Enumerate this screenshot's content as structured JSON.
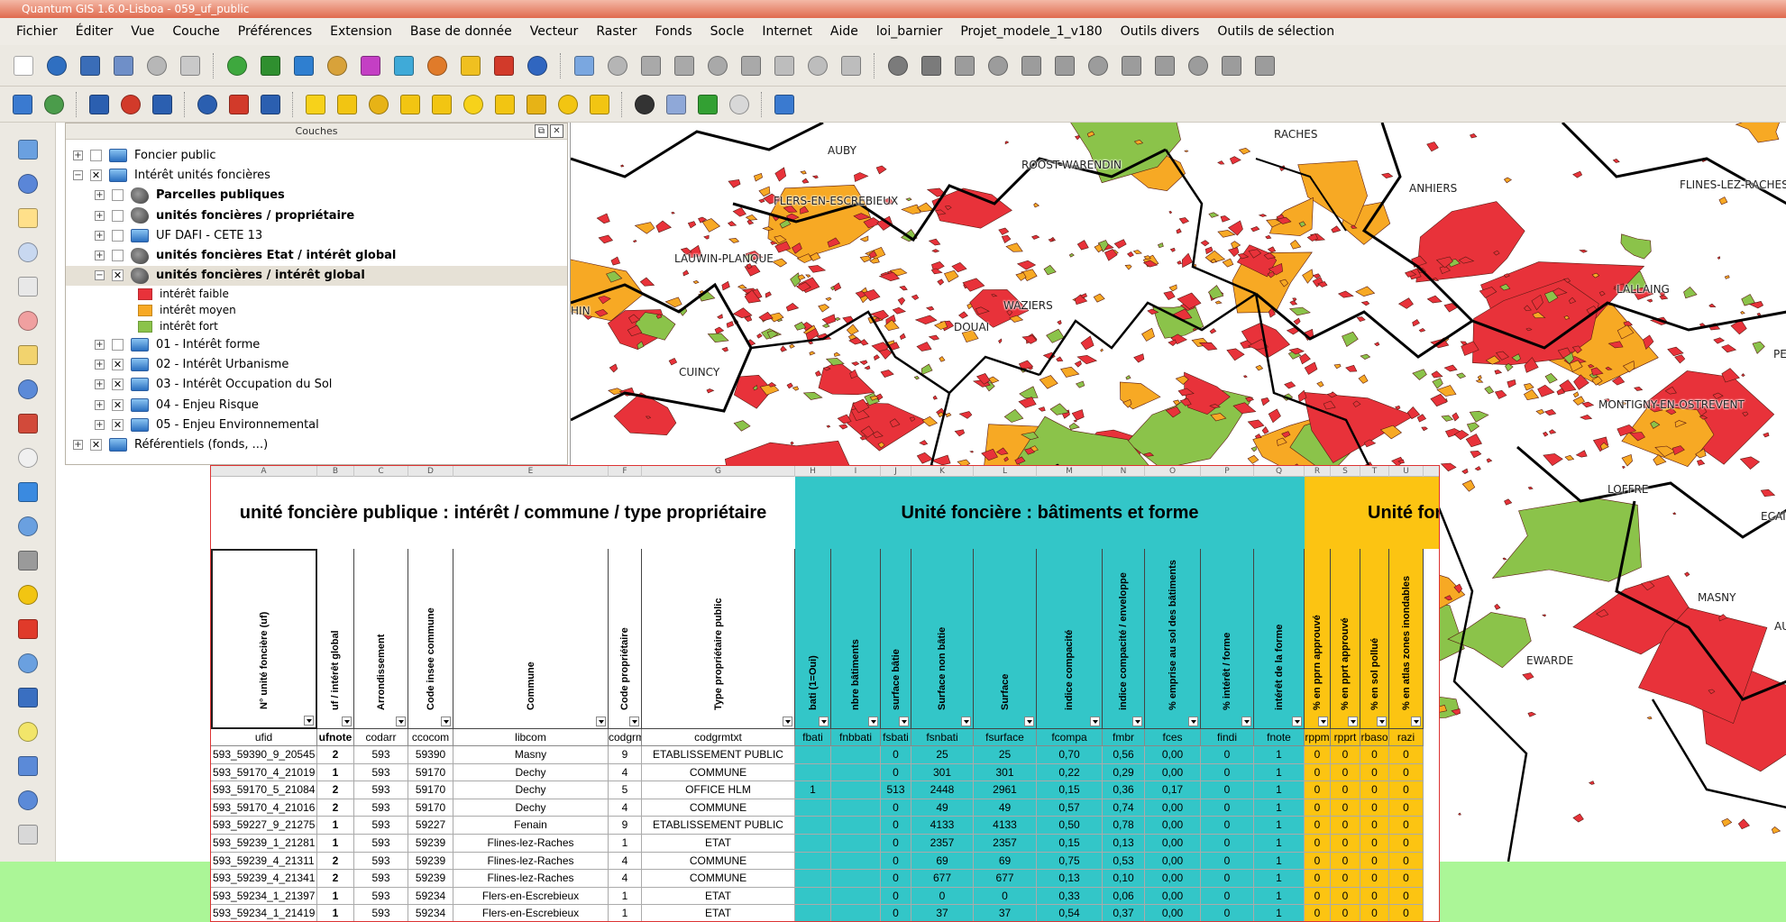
{
  "window": {
    "title": "Quantum GIS 1.6.0-Lisboa - 059_uf_public"
  },
  "menu": [
    "Fichier",
    "Éditer",
    "Vue",
    "Couche",
    "Préférences",
    "Extension",
    "Base de donnée",
    "Vecteur",
    "Raster",
    "Fonds",
    "Socle",
    "Internet",
    "Aide",
    "loi_barnier",
    "Projet_modele_1_v180",
    "Outils divers",
    "Outils de sélection"
  ],
  "toolbar1_icons": [
    {
      "name": "new-project-icon",
      "color": "#ffffff"
    },
    {
      "name": "open-project-icon",
      "color": "#2f6fc1"
    },
    {
      "name": "save-project-icon",
      "color": "#3a6db8"
    },
    {
      "name": "save-as-icon",
      "color": "#6f8fc8"
    },
    {
      "name": "print-composer-icon",
      "color": "#b7b7b7"
    },
    {
      "name": "print-icon",
      "color": "#c9c9c9"
    },
    {
      "name": "sep"
    },
    {
      "name": "add-vector-layer-icon",
      "color": "#3ea83e"
    },
    {
      "name": "add-raster-layer-icon",
      "color": "#2f8f2f"
    },
    {
      "name": "add-postgis-layer-icon",
      "color": "#2f7fd0"
    },
    {
      "name": "add-spatialite-layer-icon",
      "color": "#d8a23a"
    },
    {
      "name": "add-wms-layer-icon",
      "color": "#c43fc4"
    },
    {
      "name": "add-wfs-layer-icon",
      "color": "#3faad8"
    },
    {
      "name": "new-vector-layer-icon",
      "color": "#e07b2a"
    },
    {
      "name": "add-mssql-layer-icon",
      "color": "#f0c020"
    },
    {
      "name": "remove-layer-icon",
      "color": "#d23a2a"
    },
    {
      "name": "overview-icon",
      "color": "#3066c0"
    },
    {
      "name": "sep"
    },
    {
      "name": "pencil-icon",
      "color": "#7aa7e0"
    },
    {
      "name": "save-edits-icon",
      "color": "#b5b5b5"
    },
    {
      "name": "capture-polygon-icon",
      "color": "#a9a9a9"
    },
    {
      "name": "move-feature-icon",
      "color": "#a9a9a9"
    },
    {
      "name": "node-tool-icon",
      "color": "#a9a9a9"
    },
    {
      "name": "delete-selected-icon",
      "color": "#a9a9a9"
    },
    {
      "name": "cut-features-icon",
      "color": "#bdbdbd"
    },
    {
      "name": "copy-features-icon",
      "color": "#bdbdbd"
    },
    {
      "name": "paste-features-icon",
      "color": "#bdbdbd"
    },
    {
      "name": "sep"
    },
    {
      "name": "undo-icon",
      "color": "#7b7b7b"
    },
    {
      "name": "redo-icon",
      "color": "#7b7b7b"
    },
    {
      "name": "simplify-icon",
      "color": "#9c9c9c"
    },
    {
      "name": "add-ring-icon",
      "color": "#9c9c9c"
    },
    {
      "name": "add-part-icon",
      "color": "#9c9c9c"
    },
    {
      "name": "delete-ring-icon",
      "color": "#9c9c9c"
    },
    {
      "name": "delete-part-icon",
      "color": "#9c9c9c"
    },
    {
      "name": "reshape-icon",
      "color": "#9c9c9c"
    },
    {
      "name": "split-features-icon",
      "color": "#9c9c9c"
    },
    {
      "name": "merge-features-icon",
      "color": "#9c9c9c"
    },
    {
      "name": "rotate-point-icon",
      "color": "#9c9c9c"
    },
    {
      "name": "offset-curve-icon",
      "color": "#9c9c9c"
    }
  ],
  "toolbar2_icons": [
    {
      "name": "globe-plugin-icon",
      "color": "#3a7ad0"
    },
    {
      "name": "database-icon",
      "color": "#4b9c4b"
    },
    {
      "name": "sep"
    },
    {
      "name": "select-arrow-icon",
      "color": "#2b5fb0"
    },
    {
      "name": "select-remove-icon",
      "color": "#d23a2a"
    },
    {
      "name": "select-query-icon",
      "color": "#2b5fb0"
    },
    {
      "name": "sep"
    },
    {
      "name": "select-arrow-2-icon",
      "color": "#2b5fb0"
    },
    {
      "name": "select-remove-2-icon",
      "color": "#d23a2a"
    },
    {
      "name": "select-query-2-icon",
      "color": "#2b5fb0"
    },
    {
      "name": "sep"
    },
    {
      "name": "rectangle-yellow-icon",
      "color": "#f7d21a"
    },
    {
      "name": "polygon-yellow-icon",
      "color": "#f2c512"
    },
    {
      "name": "freehand-yellow-icon",
      "color": "#e7b316"
    },
    {
      "name": "radius-yellow-icon",
      "color": "#f2c512"
    },
    {
      "name": "polygon-select-icon",
      "color": "#f2c512"
    },
    {
      "name": "rectangle-yellow-2-icon",
      "color": "#f7d21a"
    },
    {
      "name": "polygon-yellow-2-icon",
      "color": "#f2c512"
    },
    {
      "name": "freehand-yellow-2-icon",
      "color": "#e7b316"
    },
    {
      "name": "radius-yellow-2-icon",
      "color": "#f2c512"
    },
    {
      "name": "polygon-select-2-icon",
      "color": "#f2c512"
    },
    {
      "name": "sep"
    },
    {
      "name": "flag-icon",
      "color": "#333333"
    },
    {
      "name": "edit-list-icon",
      "color": "#8fa8d8"
    },
    {
      "name": "green-check-icon",
      "color": "#33a033"
    },
    {
      "name": "checkbox-icon",
      "color": "#d8d8d8"
    },
    {
      "name": "sep"
    },
    {
      "name": "help-tool-icon",
      "color": "#3a7ad0"
    }
  ],
  "left_tools": [
    {
      "name": "pan-hand-icon",
      "color": "#6aa0e0"
    },
    {
      "name": "pan-to-selection-icon",
      "color": "#5a86d8"
    },
    {
      "name": "zoom-in-icon",
      "color": "#ffe08a"
    },
    {
      "name": "zoom-out-icon",
      "color": "#c8d8f0"
    },
    {
      "name": "zoom-full-icon",
      "color": "#e8e8e8"
    },
    {
      "name": "zoom-selection-icon",
      "color": "#f0a0a0"
    },
    {
      "name": "zoom-layer-icon",
      "color": "#f2d36e"
    },
    {
      "name": "zoom-native-icon",
      "color": "#5b8ad8"
    },
    {
      "name": "zoom-last-icon",
      "color": "#d24a3a"
    },
    {
      "name": "zoom-next-icon",
      "color": "#f0f0f0"
    },
    {
      "name": "refresh-icon",
      "color": "#3a8ae0"
    },
    {
      "name": "identify-icon",
      "color": "#6aa0e0"
    },
    {
      "name": "settings-gear-icon",
      "color": "#9a9a9a"
    },
    {
      "name": "select-features-icon",
      "color": "#f2c512"
    },
    {
      "name": "deselect-icon",
      "color": "#e03a2a"
    },
    {
      "name": "attribute-table-icon",
      "color": "#6aa0e0"
    },
    {
      "name": "measure-icon",
      "color": "#3a6fc1"
    },
    {
      "name": "annotation-icon",
      "color": "#f2e56a"
    },
    {
      "name": "map-tips-icon",
      "color": "#5b8ad8"
    },
    {
      "name": "home-icon",
      "color": "#5b8ad8"
    },
    {
      "name": "text-annotation-icon",
      "color": "#d8d8d8"
    }
  ],
  "layers_panel": {
    "title": "Couches",
    "items": [
      {
        "label": "Foncier public",
        "level": 0,
        "expand": "+",
        "check": "",
        "icon": "folder",
        "bold": false
      },
      {
        "label": "Intérêt unités foncières",
        "level": 0,
        "expand": "−",
        "check": "✕",
        "icon": "folder",
        "bold": false
      },
      {
        "label": "Parcelles publiques",
        "level": 1,
        "expand": "+",
        "check": "",
        "icon": "vector",
        "bold": true
      },
      {
        "label": "unités foncières / propriétaire",
        "level": 1,
        "expand": "+",
        "check": "",
        "icon": "vector",
        "bold": true
      },
      {
        "label": "UF DAFI - CETE 13",
        "level": 1,
        "expand": "+",
        "check": "",
        "icon": "folder",
        "bold": false
      },
      {
        "label": "unités foncières Etat / intérêt global",
        "level": 1,
        "expand": "+",
        "check": "",
        "icon": "vector",
        "bold": true
      },
      {
        "label": "unités foncières  / intérêt global",
        "level": 1,
        "expand": "−",
        "check": "✕",
        "icon": "vector",
        "bold": true,
        "selected": true
      }
    ],
    "legend": [
      {
        "label": "intérêt faible",
        "color": "#e8323a"
      },
      {
        "label": "intérêt moyen",
        "color": "#f7a924"
      },
      {
        "label": "intérêt fort",
        "color": "#8bc34a"
      }
    ],
    "items_after": [
      {
        "label": "01 - Intérêt forme",
        "level": 1,
        "expand": "+",
        "check": "",
        "icon": "folder"
      },
      {
        "label": "02 - Intérêt Urbanisme",
        "level": 1,
        "expand": "+",
        "check": "✕",
        "icon": "folder"
      },
      {
        "label": "03 - Intérêt Occupation du Sol",
        "level": 1,
        "expand": "+",
        "check": "✕",
        "icon": "folder"
      },
      {
        "label": "04 - Enjeu Risque",
        "level": 1,
        "expand": "+",
        "check": "✕",
        "icon": "folder"
      },
      {
        "label": "05 - Enjeu Environnemental",
        "level": 1,
        "expand": "+",
        "check": "✕",
        "icon": "folder"
      },
      {
        "label": "Référentiels (fonds, ...)",
        "level": 0,
        "expand": "+",
        "check": "✕",
        "icon": "folder"
      }
    ]
  },
  "map": {
    "places": [
      "RACHES",
      "AUBY",
      "ROOST-WARENDIN",
      "ANHIERS",
      "FLINES-LEZ-RACHES",
      "FLERS-EN-ESCREBIEUX",
      "LAUWIN-PLANQUE",
      "LALLAING",
      "WAZIERS",
      "HIN",
      "DOUAI",
      "CUINCY",
      "MONTIGNY-EN-OSTREVENT",
      "PE",
      "LOFFRE",
      "ECAIL",
      "MASNY",
      "EWARDE",
      "AU"
    ],
    "colors": {
      "faible": "#e8323a",
      "moyen": "#f7a924",
      "fort": "#8bc34a",
      "border": "#000000"
    }
  },
  "sheet": {
    "col_letters": [
      "A",
      "B",
      "C",
      "D",
      "E",
      "F",
      "G",
      "H",
      "I",
      "J",
      "K",
      "L",
      "M",
      "N",
      "O",
      "P",
      "Q",
      "R",
      "S",
      "T",
      "U"
    ],
    "section_titles": {
      "white": "unité foncière publique : intérêt / commune / type propriétaire",
      "teal": "Unité foncière : bâtiments et forme",
      "yellow": "Unité for"
    },
    "headers": [
      "N° unité foncière (uf)",
      "uf / intérêt global",
      "Arrondissement",
      "Code insee commune",
      "Commune",
      "Code propriétaire",
      "Type propriétaire public",
      "bati (1=Oui)",
      "nbre bâtiments",
      "surface bâtie",
      "Surface non bâtie",
      "Surface",
      "indice compacité",
      "indice compacité / enveloppe",
      "% emprise au sol des bâtiments",
      "% intérêt / forme",
      "intérêt de la forme",
      "% en pprn approuvé",
      "% en pprt approuvé",
      "% en sol pollué",
      "% en atlas zones inondables"
    ],
    "codes": [
      "ufid",
      "ufnote",
      "codarr",
      "ccocom",
      "libcom",
      "codgrm",
      "codgrmtxt",
      "fbati",
      "fnbbati",
      "fsbati",
      "fsnbati",
      "fsurface",
      "fcompa",
      "fmbr",
      "fces",
      "findi",
      "fnote",
      "rppm",
      "rpprt",
      "rbaso",
      "razi"
    ],
    "rows": [
      [
        "593_59390_9_20545",
        "2",
        "593",
        "59390",
        "Masny",
        "9",
        "ETABLISSEMENT PUBLIC",
        "",
        "",
        "0",
        "25",
        "25",
        "0,70",
        "0,56",
        "0,00",
        "0",
        "1",
        "0",
        "0",
        "0",
        "0"
      ],
      [
        "593_59170_4_21019",
        "1",
        "593",
        "59170",
        "Dechy",
        "4",
        "COMMUNE",
        "",
        "",
        "0",
        "301",
        "301",
        "0,22",
        "0,29",
        "0,00",
        "0",
        "1",
        "0",
        "0",
        "0",
        "0"
      ],
      [
        "593_59170_5_21084",
        "2",
        "593",
        "59170",
        "Dechy",
        "5",
        "OFFICE HLM",
        "1",
        "",
        "513",
        "2448",
        "2961",
        "0,15",
        "0,36",
        "0,17",
        "0",
        "1",
        "0",
        "0",
        "0",
        "0"
      ],
      [
        "593_59170_4_21016",
        "2",
        "593",
        "59170",
        "Dechy",
        "4",
        "COMMUNE",
        "",
        "",
        "0",
        "49",
        "49",
        "0,57",
        "0,74",
        "0,00",
        "0",
        "1",
        "0",
        "0",
        "0",
        "0"
      ],
      [
        "593_59227_9_21275",
        "1",
        "593",
        "59227",
        "Fenain",
        "9",
        "ETABLISSEMENT PUBLIC",
        "",
        "",
        "0",
        "4133",
        "4133",
        "0,50",
        "0,78",
        "0,00",
        "0",
        "1",
        "0",
        "0",
        "0",
        "0"
      ],
      [
        "593_59239_1_21281",
        "1",
        "593",
        "59239",
        "Flines-lez-Raches",
        "1",
        "ETAT",
        "",
        "",
        "0",
        "2357",
        "2357",
        "0,15",
        "0,13",
        "0,00",
        "0",
        "1",
        "0",
        "0",
        "0",
        "0"
      ],
      [
        "593_59239_4_21311",
        "2",
        "593",
        "59239",
        "Flines-lez-Raches",
        "4",
        "COMMUNE",
        "",
        "",
        "0",
        "69",
        "69",
        "0,75",
        "0,53",
        "0,00",
        "0",
        "1",
        "0",
        "0",
        "0",
        "0"
      ],
      [
        "593_59239_4_21341",
        "2",
        "593",
        "59239",
        "Flines-lez-Raches",
        "4",
        "COMMUNE",
        "",
        "",
        "0",
        "677",
        "677",
        "0,13",
        "0,10",
        "0,00",
        "0",
        "1",
        "0",
        "0",
        "0",
        "0"
      ],
      [
        "593_59234_1_21397",
        "1",
        "593",
        "59234",
        "Flers-en-Escrebieux",
        "1",
        "ETAT",
        "",
        "",
        "0",
        "0",
        "0",
        "0,33",
        "0,06",
        "0,00",
        "0",
        "1",
        "0",
        "0",
        "0",
        "0"
      ],
      [
        "593_59234_1_21419",
        "1",
        "593",
        "59234",
        "Flers-en-Escrebieux",
        "1",
        "ETAT",
        "",
        "",
        "0",
        "37",
        "37",
        "0,54",
        "0,37",
        "0,00",
        "0",
        "1",
        "0",
        "0",
        "0",
        "0"
      ]
    ],
    "colors": {
      "teal": "#33c6c8",
      "yellow": "#fcc412"
    }
  }
}
